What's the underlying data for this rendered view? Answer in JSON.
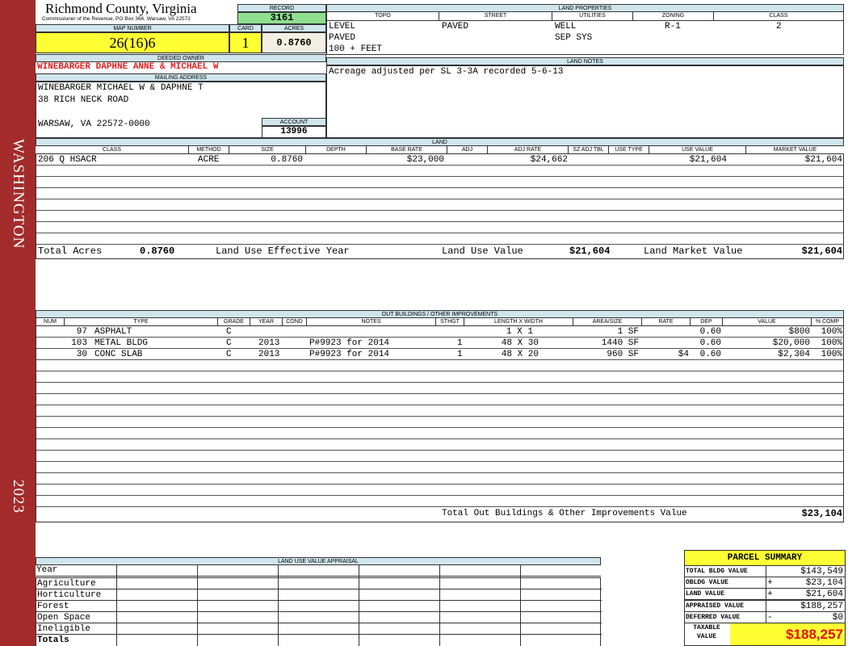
{
  "sidebar": {
    "top_text": "WASHINGTON",
    "bottom_text": "2023"
  },
  "header": {
    "county": "Richmond County, Virginia",
    "address": "Commissioner of the Revenue, PO Box 366, Warsaw, VA 22572",
    "record_label": "RECORD",
    "record": "3161",
    "map_label": "MAP NUMBER",
    "map_number": "26(16)6",
    "card_label": "CARD",
    "card": "1",
    "acres_label": "ACRES",
    "acres": "0.8760"
  },
  "owner": {
    "deeded_label": "DEEDED OWNER",
    "deeded_owner": "WINEBARGER DAPHNE ANNE & MICHAEL W",
    "mailing_label": "MAILING ADDRESS",
    "mail_line1": "WINEBARGER MICHAEL W & DAPHNE T",
    "mail_line2": "38 RICH NECK ROAD",
    "mail_line3": "WARSAW, VA 22572-0000",
    "account_label": "ACCOUNT",
    "account": "13996"
  },
  "land_properties": {
    "title": "LAND PROPERTIES",
    "headers": [
      "TOPO",
      "STREET",
      "UTILITIES",
      "ZONING",
      "CLASS"
    ],
    "topo": [
      "LEVEL",
      "PAVED",
      "100 + FEET"
    ],
    "street": "PAVED",
    "utilities": [
      "WELL",
      "SEP SYS"
    ],
    "zoning": "R-1",
    "class": "2"
  },
  "land_notes": {
    "title": "LAND NOTES",
    "text": "Acreage adjusted per SL 3-3A recorded 5-6-13"
  },
  "land": {
    "title": "LAND",
    "headers": [
      "CLASS",
      "METHOD",
      "SIZE",
      "DEPTH",
      "BASE RATE",
      "ADJ",
      "ADJ RATE",
      "SZ ADJ TBL",
      "USE TYPE",
      "USE VALUE",
      "MARKET VALUE"
    ],
    "rows": [
      {
        "class": "206 Q HSACR",
        "method": "ACRE",
        "size": "0.8760",
        "depth": "",
        "base_rate": "$23,000",
        "adj": "",
        "adj_rate": "$24,662",
        "sz_adj": "",
        "use_type": "",
        "use_value": "$21,604",
        "market_value": "$21,604"
      }
    ],
    "total_acres_label": "Total Acres",
    "total_acres": "0.8760",
    "effective_year_label": "Land Use Effective Year",
    "use_value_label": "Land Use Value",
    "use_value": "$21,604",
    "market_value_label": "Land Market Value",
    "market_value": "$21,604"
  },
  "outbuildings": {
    "title": "OUT BUILDINGS / OTHER IMPROVEMENTS",
    "headers": [
      "NUM",
      "TYPE",
      "GRADE",
      "YEAR",
      "COND",
      "NOTES",
      "STHGT",
      "LENGTH X WIDTH",
      "AREA/SIZE",
      "RATE",
      "DEP",
      "VALUE",
      "% COMP"
    ],
    "rows": [
      {
        "num": "97",
        "type": "ASPHALT",
        "grade": "C",
        "year": "",
        "cond": "",
        "notes": "",
        "sthgt": "",
        "lw": "1 X 1",
        "area": "1 SF",
        "rate": "",
        "dep": "0.60",
        "value": "$800",
        "comp": "100%"
      },
      {
        "num": "103",
        "type": "METAL BLDG",
        "grade": "C",
        "year": "2013",
        "cond": "",
        "notes": "P#9923 for 2014",
        "sthgt": "1",
        "lw": "48 X 30",
        "area": "1440 SF",
        "rate": "",
        "dep": "0.60",
        "value": "$20,000",
        "comp": "100%"
      },
      {
        "num": "30",
        "type": "CONC SLAB",
        "grade": "C",
        "year": "2013",
        "cond": "",
        "notes": "P#9923 for 2014",
        "sthgt": "1",
        "lw": "48 X 20",
        "area": "960 SF",
        "rate": "$4",
        "dep": "0.60",
        "value": "$2,304",
        "comp": "100%"
      }
    ],
    "total_label": "Total Out Buildings & Other Improvements Value",
    "total": "$23,104"
  },
  "land_use_appraisal": {
    "title": "LAND USE VALUE APPRAISAL",
    "rows": [
      "Year",
      "Agriculture",
      "Horticulture",
      "Forest",
      "Open Space",
      "Ineligible",
      "Totals"
    ]
  },
  "parcel_summary": {
    "title": "PARCEL SUMMARY",
    "rows": [
      {
        "label": "TOTAL BLDG VALUE",
        "sign": "",
        "value": "$143,549"
      },
      {
        "label": "OBLDG VALUE",
        "sign": "+",
        "value": "$23,104"
      },
      {
        "label": "LAND VALUE",
        "sign": "+",
        "value": "$21,604"
      },
      {
        "label": "APPRAISED VALUE",
        "sign": "",
        "value": "$188,257"
      },
      {
        "label": "DEFERRED VALUE",
        "sign": "-",
        "value": "$0"
      }
    ],
    "taxable_label_1": "TAXABLE",
    "taxable_label_2": "VALUE",
    "taxable_value": "$188,257"
  }
}
